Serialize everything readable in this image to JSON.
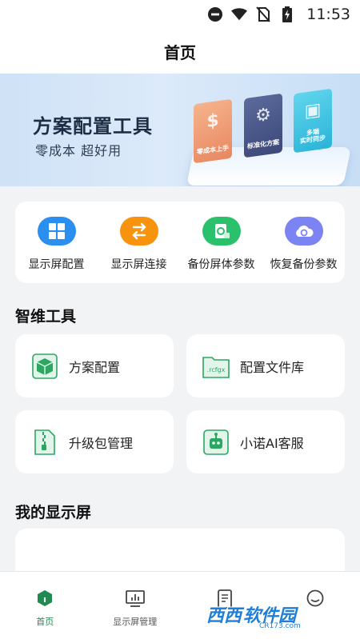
{
  "status_bar": {
    "time": "11:53",
    "icons": [
      "do-not-disturb-icon",
      "wifi-icon",
      "no-sim-icon",
      "battery-charging-icon"
    ]
  },
  "header": {
    "title": "首页"
  },
  "banner": {
    "title": "方案配置工具",
    "subtitle": "零成本 超好用",
    "cards": [
      {
        "label": "零成本上手",
        "icon": "dollar-icon",
        "color": "#e98a62"
      },
      {
        "label": "标准化方案",
        "icon": "gear-doc-icon",
        "color": "#3f4c7c"
      },
      {
        "label": "多端\n实时同步",
        "icon": "monitor-chart-icon",
        "color": "#2cb5da"
      }
    ]
  },
  "quick_actions": [
    {
      "label": "显示屏配置",
      "icon": "grid-settings-icon",
      "color": "#2b8ff0"
    },
    {
      "label": "显示屏连接",
      "icon": "link-arrows-icon",
      "color": "#f7930e"
    },
    {
      "label": "备份屏体参数",
      "icon": "backup-doc-icon",
      "color": "#2bc16c"
    },
    {
      "label": "恢复备份参数",
      "icon": "cloud-restore-icon",
      "color": "#7b84f2"
    }
  ],
  "tools_section": {
    "title": "智维工具",
    "items": [
      {
        "label": "方案配置",
        "icon": "cube-icon"
      },
      {
        "label": "配置文件库",
        "icon": "folder-rcfgx-icon",
        "folder_text": ".rcfgx"
      },
      {
        "label": "升级包管理",
        "icon": "zip-package-icon"
      },
      {
        "label": "小诺AI客服",
        "icon": "robot-support-icon"
      }
    ]
  },
  "screens_section": {
    "title": "我的显示屏"
  },
  "bottom_nav": [
    {
      "label": "首页",
      "icon": "home-hexagon-icon",
      "active": true
    },
    {
      "label": "显示屏管理",
      "icon": "monitor-icon",
      "active": false
    },
    {
      "label": "",
      "icon": "document-icon",
      "active": false
    },
    {
      "label": "",
      "icon": "profile-icon",
      "active": false
    }
  ],
  "watermark": {
    "text_a": "西西",
    "text_b": "软件园",
    "domain": "CR173.com"
  },
  "colors": {
    "accent_green": "#1f8a52",
    "background": "#f2f3f5"
  }
}
